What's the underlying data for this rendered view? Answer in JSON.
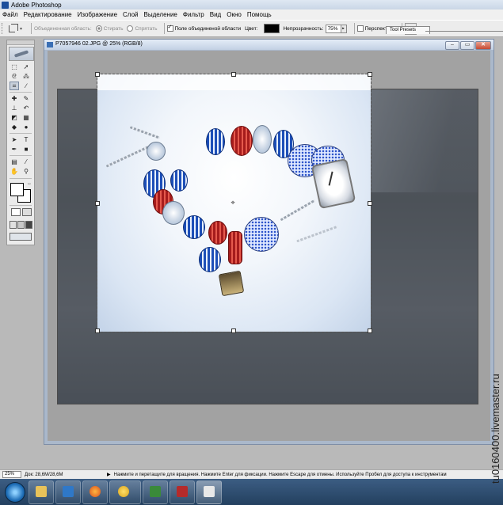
{
  "app": {
    "title": "Adobe Photoshop"
  },
  "menu": [
    "Файл",
    "Редактирование",
    "Изображение",
    "Слой",
    "Выделение",
    "Фильтр",
    "Вид",
    "Окно",
    "Помощь"
  ],
  "options": {
    "combined_area_label": "Объединенная область:",
    "erase_label": "Стирать",
    "hide_label": "Спрятать",
    "combined_field_label": "Поле объединеной области",
    "color_label": "Цвет:",
    "opacity_label": "Непрозрачность:",
    "opacity_value": "75%",
    "perspective_label": "Перспектива",
    "tool_presets_tab": "Tool Presets"
  },
  "document": {
    "title": "P7057946 02.JPG @ 25% (RGB/8)",
    "window_buttons": [
      "‒",
      "▭",
      "✕"
    ]
  },
  "status": {
    "zoom": "25%",
    "doc_size": "Док: 28,6M/28,6M",
    "hint": "Нажмите и перетащите для вращения. Нажмите Enter для фиксации. Нажмите Escape для отмены. Используйте Пробел для доступа к инструментам"
  },
  "watermark": "tu0160400.livemaster.ru",
  "colors": {
    "accent": "#1c4f9c",
    "taskbar": "#2b4a6d"
  }
}
